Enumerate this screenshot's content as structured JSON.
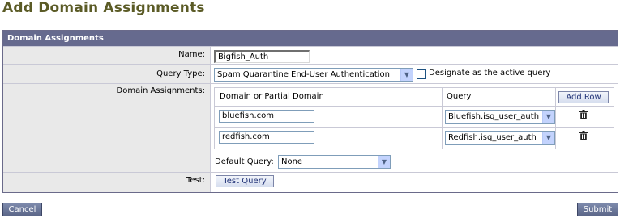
{
  "page": {
    "title": "Add Domain Assignments"
  },
  "panel": {
    "header": "Domain Assignments",
    "name": {
      "label": "Name:",
      "value": "Bigfish_Auth"
    },
    "query_type": {
      "label": "Query Type:",
      "selected": "Spam Quarantine End-User Authentication",
      "active_checkbox_label": "Designate as the active query",
      "active_checked": false
    },
    "domain_assignments": {
      "label": "Domain Assignments:",
      "col_domain": "Domain or Partial Domain",
      "col_query": "Query",
      "add_row_label": "Add Row",
      "rows": [
        {
          "domain": "bluefish.com",
          "query": "Bluefish.isq_user_auth"
        },
        {
          "domain": "redfish.com",
          "query": "Redfish.isq_user_auth"
        }
      ],
      "default_query_label": "Default Query:",
      "default_query_value": "None"
    },
    "test": {
      "label": "Test:",
      "button_label": "Test Query"
    }
  },
  "footer": {
    "cancel_label": "Cancel",
    "submit_label": "Submit"
  },
  "colors": {
    "title": "#5b5b26",
    "header_bg": "#666a8e",
    "label_bg": "#e9e9e9"
  },
  "icons": [
    "chevron-down-icon",
    "trash-icon"
  ]
}
